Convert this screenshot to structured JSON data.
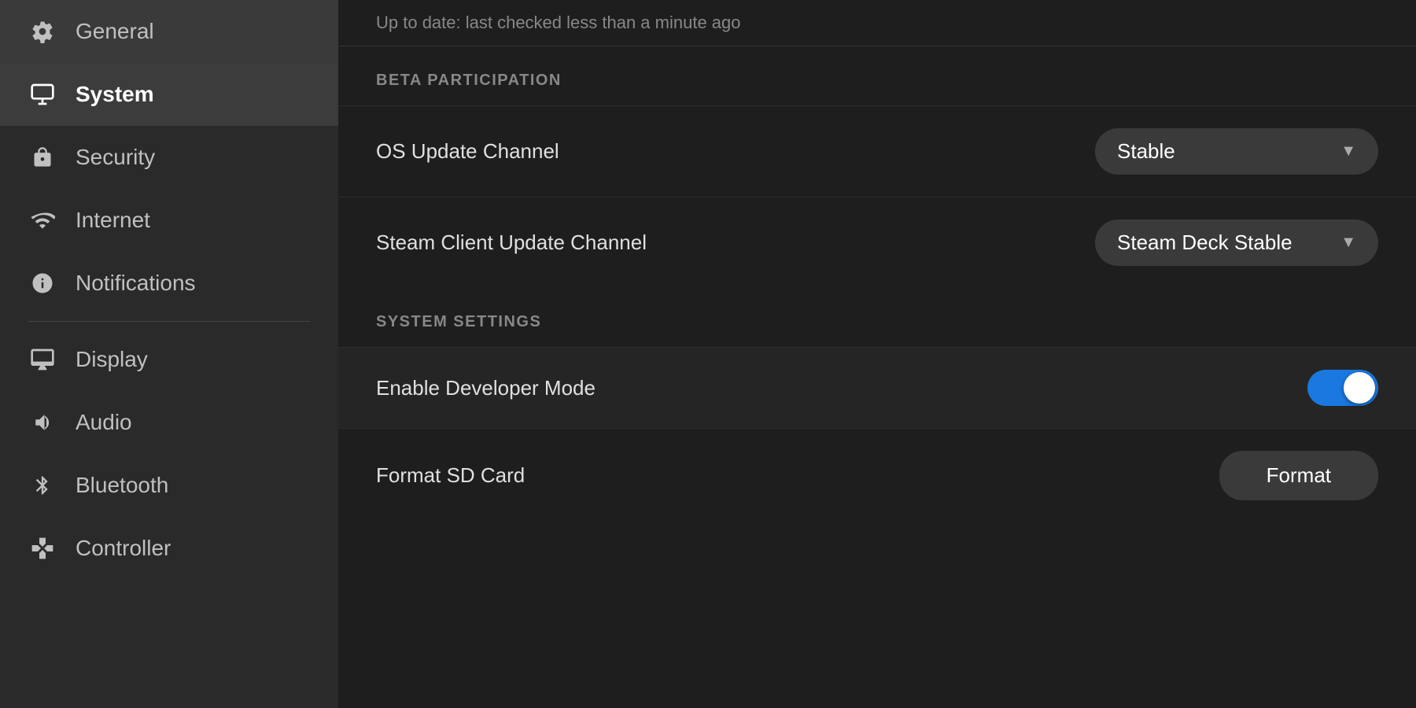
{
  "sidebar": {
    "items": [
      {
        "id": "general",
        "label": "General",
        "icon": "gear-icon",
        "active": false
      },
      {
        "id": "system",
        "label": "System",
        "icon": "system-icon",
        "active": true
      },
      {
        "id": "security",
        "label": "Security",
        "icon": "lock-icon",
        "active": false
      },
      {
        "id": "internet",
        "label": "Internet",
        "icon": "wifi-icon",
        "active": false
      },
      {
        "id": "notifications",
        "label": "Notifications",
        "icon": "info-icon",
        "active": false
      },
      {
        "id": "display",
        "label": "Display",
        "icon": "display-icon",
        "active": false
      },
      {
        "id": "audio",
        "label": "Audio",
        "icon": "audio-icon",
        "active": false
      },
      {
        "id": "bluetooth",
        "label": "Bluetooth",
        "icon": "bluetooth-icon",
        "active": false
      },
      {
        "id": "controller",
        "label": "Controller",
        "icon": "controller-icon",
        "active": false
      }
    ]
  },
  "main": {
    "top_status": "Up to date: last checked less than a minute ago",
    "sections": [
      {
        "id": "beta-participation",
        "header": "BETA PARTICIPATION",
        "settings": [
          {
            "id": "os-update-channel",
            "label": "OS Update Channel",
            "type": "dropdown",
            "value": "Stable"
          },
          {
            "id": "steam-client-update-channel",
            "label": "Steam Client Update Channel",
            "type": "dropdown",
            "value": "Steam Deck Stable"
          }
        ]
      },
      {
        "id": "system-settings",
        "header": "SYSTEM SETTINGS",
        "settings": [
          {
            "id": "enable-developer-mode",
            "label": "Enable Developer Mode",
            "type": "toggle",
            "value": true
          },
          {
            "id": "format-sd-card",
            "label": "Format SD Card",
            "type": "button",
            "button_label": "Format"
          }
        ]
      }
    ]
  }
}
